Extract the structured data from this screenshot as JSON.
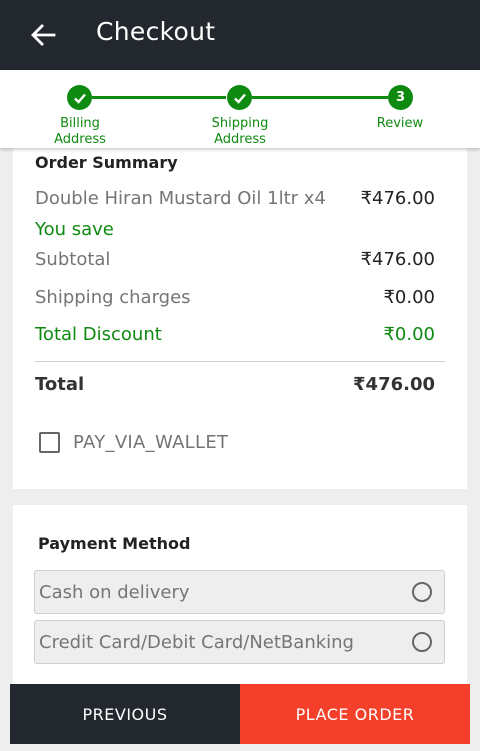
{
  "header": {
    "title": "Checkout"
  },
  "steps": [
    {
      "label": "Billing\nAddress",
      "marker": "✓"
    },
    {
      "label": "Shipping\nAddress",
      "marker": "✓"
    },
    {
      "label": "Review",
      "marker": "3"
    }
  ],
  "order_summary": {
    "title": "Order Summary",
    "item": {
      "name": "Double Hiran Mustard Oil 1ltr x4",
      "price": "₹476.00"
    },
    "you_save_label": "You save",
    "subtotal": {
      "label": "Subtotal",
      "value": "₹476.00"
    },
    "shipping": {
      "label": "Shipping charges",
      "value": "₹0.00"
    },
    "discount": {
      "label": "Total Discount",
      "value": "₹0.00"
    },
    "total": {
      "label": "Total",
      "value": "₹476.00"
    }
  },
  "wallet": {
    "label": "PAY_VIA_WALLET",
    "checked": false
  },
  "payment": {
    "title": "Payment Method",
    "options": [
      {
        "label": "Cash on delivery"
      },
      {
        "label": "Credit Card/Debit Card/NetBanking"
      }
    ]
  },
  "footer": {
    "previous_label": "PREVIOUS",
    "place_order_label": "PLACE ORDER"
  },
  "colors": {
    "header_bg": "#23272e",
    "accent_green": "#0f8a10",
    "place_order_bg": "#f4402a"
  }
}
